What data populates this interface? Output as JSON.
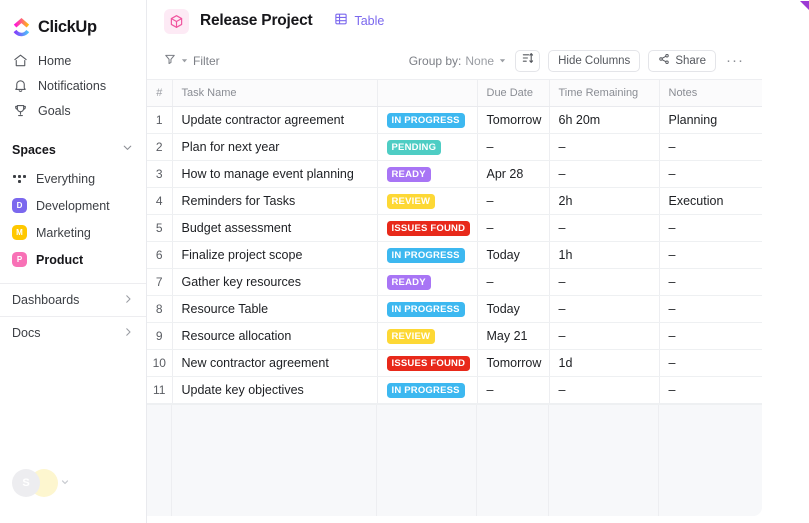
{
  "brand": {
    "name": "ClickUp",
    "logo_icon": "clickup-logo-icon"
  },
  "sidebar": {
    "nav": [
      {
        "label": "Home",
        "icon": "home-icon"
      },
      {
        "label": "Notifications",
        "icon": "bell-icon"
      },
      {
        "label": "Goals",
        "icon": "trophy-icon"
      }
    ],
    "spaces_header": {
      "label": "Spaces",
      "chevron": "chevron-down-icon"
    },
    "spaces": [
      {
        "label": "Everything",
        "badge": "",
        "color": "",
        "icon": "grid-dots-icon",
        "selected": false
      },
      {
        "label": "Development",
        "badge": "D",
        "color": "#7b68ee",
        "selected": false
      },
      {
        "label": "Marketing",
        "badge": "M",
        "color": "#ffc800",
        "selected": false
      },
      {
        "label": "Product",
        "badge": "P",
        "color": "#f871b6",
        "selected": true
      }
    ],
    "links": [
      {
        "label": "Dashboards",
        "arrow": "chevron-right-icon"
      },
      {
        "label": "Docs",
        "arrow": "chevron-right-icon"
      }
    ],
    "user": {
      "initial": "S",
      "caret": "chevron-down-icon"
    }
  },
  "header": {
    "project_icon": "cube-icon",
    "project_title": "Release Project",
    "view_tab": {
      "label": "Table",
      "icon": "table-grid-icon"
    }
  },
  "toolbar": {
    "filter_label": "Filter",
    "filter_icon": "funnel-icon",
    "group_by_label": "Group by:",
    "group_by_value": "None",
    "sort_icon": "sort-icon",
    "hide_columns_label": "Hide Columns",
    "share_label": "Share",
    "share_icon": "share-icon",
    "more_label": "···"
  },
  "table": {
    "columns": [
      "#",
      "Task Name",
      "",
      "Due Date",
      "Time Remaining",
      "Notes"
    ],
    "rows": [
      {
        "num": "1",
        "task": "Update contractor agreement",
        "status": "IN PROGRESS",
        "status_color": "#3db8f0",
        "due": "Tomorrow",
        "due_warn": false,
        "time": "6h 20m",
        "notes": "Planning"
      },
      {
        "num": "2",
        "task": "Plan for next year",
        "status": "PENDING",
        "status_color": "#4ecdc4",
        "due": "–",
        "due_warn": false,
        "time": "–",
        "notes": "–"
      },
      {
        "num": "3",
        "task": "How to manage event planning",
        "status": "READY",
        "status_color": "#a875f5",
        "due": "Apr 28",
        "due_warn": true,
        "time": "–",
        "notes": "–"
      },
      {
        "num": "4",
        "task": "Reminders for Tasks",
        "status": "REVIEW",
        "status_color": "#fdd835",
        "due": "–",
        "due_warn": false,
        "time": "2h",
        "notes": "Execution"
      },
      {
        "num": "5",
        "task": "Budget assessment",
        "status": "ISSUES FOUND",
        "status_color": "#e8291a",
        "due": "–",
        "due_warn": false,
        "time": "–",
        "notes": "–"
      },
      {
        "num": "6",
        "task": "Finalize project  scope",
        "status": "IN PROGRESS",
        "status_color": "#3db8f0",
        "due": "Today",
        "due_warn": true,
        "time": "1h",
        "notes": "–"
      },
      {
        "num": "7",
        "task": "Gather key resources",
        "status": "READY",
        "status_color": "#a875f5",
        "due": "–",
        "due_warn": false,
        "time": "–",
        "notes": "–"
      },
      {
        "num": "8",
        "task": "Resource Table",
        "status": "IN PROGRESS",
        "status_color": "#3db8f0",
        "due": "Today",
        "due_warn": true,
        "time": "–",
        "notes": "–"
      },
      {
        "num": "9",
        "task": "Resource allocation",
        "status": "REVIEW",
        "status_color": "#fdd835",
        "due": "May 21",
        "due_warn": false,
        "time": "–",
        "notes": "–"
      },
      {
        "num": "10",
        "task": "New contractor agreement",
        "status": "ISSUES FOUND",
        "status_color": "#e8291a",
        "due": "Tomorrow",
        "due_warn": false,
        "time": "1d",
        "notes": "–"
      },
      {
        "num": "11",
        "task": "Update key objectives",
        "status": "IN PROGRESS",
        "status_color": "#3db8f0",
        "due": "–",
        "due_warn": false,
        "time": "–",
        "notes": "–"
      }
    ]
  }
}
